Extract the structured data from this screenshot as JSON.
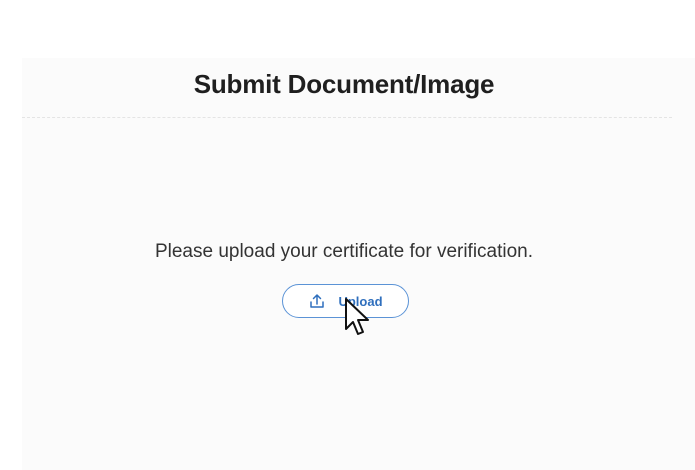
{
  "header": {
    "title": "Submit Document/Image"
  },
  "main": {
    "message": "Please upload your certificate for verification.",
    "upload_button": {
      "label": "Upload",
      "icon": "upload-icon"
    }
  },
  "colors": {
    "accent": "#2f6fbd",
    "button_border": "#5b93d6",
    "panel_background": "#fbfbfb"
  }
}
